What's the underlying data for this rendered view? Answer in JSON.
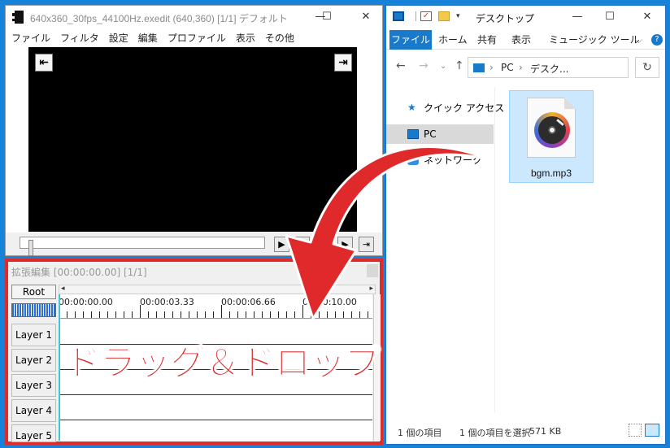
{
  "aviutl": {
    "title": "640x360_30fps_44100Hz.exedit (640,360)  [1/1]  デフォルト",
    "menu": [
      "ファイル",
      "フィルタ",
      "設定",
      "編集",
      "プロファイル",
      "表示",
      "その他"
    ]
  },
  "timeline": {
    "title": "拡張編集 [00:00:00.00] [1/1]",
    "root_label": "Root",
    "time_labels": [
      "00:00:00.00",
      "00:00:03.33",
      "00:00:06.66",
      "00:00:10.00"
    ],
    "layers": [
      "Layer 1",
      "Layer 2",
      "Layer 3",
      "Layer 4",
      "Layer 5"
    ]
  },
  "overlay": {
    "caption": "ドラッグ＆ドロップ",
    "arrow_color": "#e0292b"
  },
  "explorer": {
    "title": "デスクトップ",
    "ribbon_tabs": [
      "ファイル",
      "ホーム",
      "共有",
      "表示",
      "ミュージック ツール"
    ],
    "address": [
      "PC",
      "デスク..."
    ],
    "nav_items": [
      "クイック アクセス",
      "PC",
      "ネットワーク"
    ],
    "file_name": "bgm.mp3",
    "status": {
      "count": "1 個の項目",
      "selected": "1 個の項目を選択",
      "size": "571 KB"
    }
  },
  "colors": {
    "desktop": "#1683d8",
    "accent": "#1979ca",
    "highlight": "#e02b2b"
  }
}
